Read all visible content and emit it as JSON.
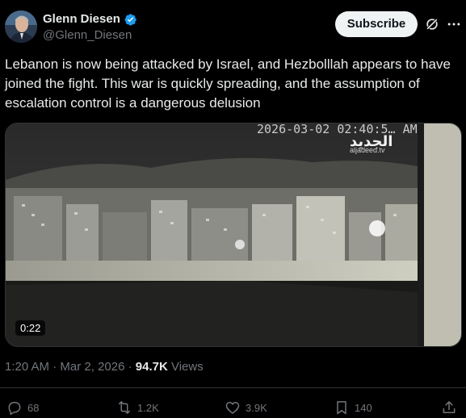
{
  "author": {
    "display_name": "Glenn Diesen",
    "handle": "@Glenn_Diesen",
    "verified": true
  },
  "header": {
    "subscribe_label": "Subscribe"
  },
  "tweet": {
    "text": "Lebanon is now being attacked by Israel, and Hezbolllah appears to have joined the fight. This war is quickly spreading, and the assumption of escalation control is a dangerous delusion"
  },
  "media": {
    "overlay_timestamp": "2026-03-02 02:40:5… AM",
    "overlay_logo": "الجديد",
    "overlay_logo_sub": "aljadeed.tv",
    "duration": "0:22"
  },
  "meta": {
    "time": "1:20 AM",
    "date": "Mar 2, 2026",
    "separator": "·",
    "views_count": "94.7K",
    "views_label": "Views"
  },
  "actions": {
    "replies": "68",
    "reposts": "1.2K",
    "likes": "3.9K",
    "bookmarks": "140"
  },
  "colors": {
    "background": "#000000",
    "text": "#e7e9ea",
    "muted": "#71767b",
    "verified": "#1d9bf0",
    "border": "#2f3336"
  }
}
